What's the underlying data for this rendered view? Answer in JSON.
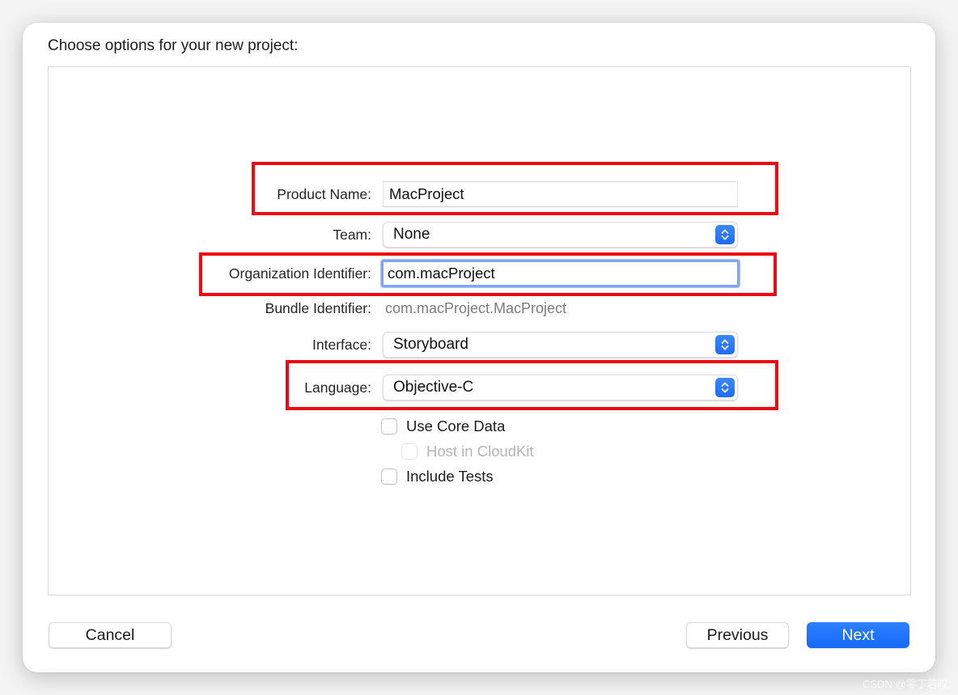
{
  "dialog": {
    "title": "Choose options for your new project:"
  },
  "form": {
    "product_name": {
      "label": "Product Name:",
      "value": "MacProject"
    },
    "team": {
      "label": "Team:",
      "value": "None",
      "icon": "stepper-updown-icon"
    },
    "organization_identifier": {
      "label": "Organization Identifier:",
      "value": "com.macProject",
      "focused": true
    },
    "bundle_identifier": {
      "label": "Bundle Identifier:",
      "value": "com.macProject.MacProject"
    },
    "interface": {
      "label": "Interface:",
      "value": "Storyboard",
      "icon": "stepper-updown-icon"
    },
    "language": {
      "label": "Language:",
      "value": "Objective-C",
      "icon": "stepper-updown-icon"
    }
  },
  "options": [
    {
      "label": "Use Core Data",
      "checked": false,
      "enabled": true
    },
    {
      "label": "Host in CloudKit",
      "checked": false,
      "enabled": false
    },
    {
      "label": "Include Tests",
      "checked": false,
      "enabled": true
    }
  ],
  "buttons": {
    "cancel": "Cancel",
    "previous": "Previous",
    "next": "Next"
  },
  "annotations": {
    "highlight_color": "#ee0a14",
    "highlighted_fields": [
      "Product Name",
      "Organization Identifier",
      "Language"
    ]
  },
  "colors": {
    "accent": "#1469f7",
    "focus_ring": "#7ea6f3"
  },
  "watermark": "CSDN @零丁若叹"
}
